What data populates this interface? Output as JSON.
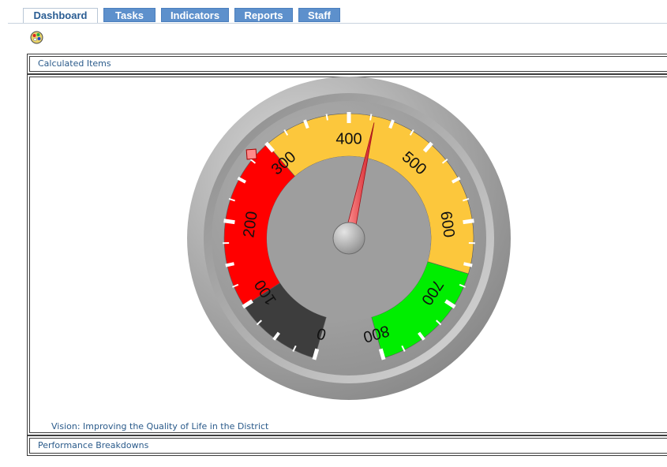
{
  "tabs": [
    {
      "label": "Dashboard",
      "active": true
    },
    {
      "label": "Tasks",
      "active": false
    },
    {
      "label": "Indicators",
      "active": false
    },
    {
      "label": "Reports",
      "active": false
    },
    {
      "label": "Staff",
      "active": false
    }
  ],
  "toolbar": {
    "icon": "color-palette-icon"
  },
  "panels": {
    "calculated": {
      "title": "Calculated Items"
    },
    "gauge": {
      "vision_link": "Vision: Improving the Quality of Life in the District"
    },
    "breakdowns": {
      "title": "Performance Breakdowns"
    }
  },
  "gauge_data": {
    "min": 0,
    "max": 800,
    "value": 430,
    "major_ticks": [
      "0",
      "100",
      "200",
      "300",
      "400",
      "500",
      "600",
      "700",
      "800"
    ],
    "bands": [
      {
        "from": 0,
        "to": 100,
        "color": "#3d3d3d"
      },
      {
        "from": 100,
        "to": 300,
        "color": "#ff0000"
      },
      {
        "from": 300,
        "to": 660,
        "color": "#fcc73c"
      },
      {
        "from": 660,
        "to": 800,
        "color": "#00ee00"
      }
    ],
    "colors": {
      "needle": "#e8202a",
      "outer_ring": "#a9a9a9",
      "face": "#9a9a9a"
    },
    "marker_value": 280,
    "marker_color": "#ff8a8a"
  }
}
